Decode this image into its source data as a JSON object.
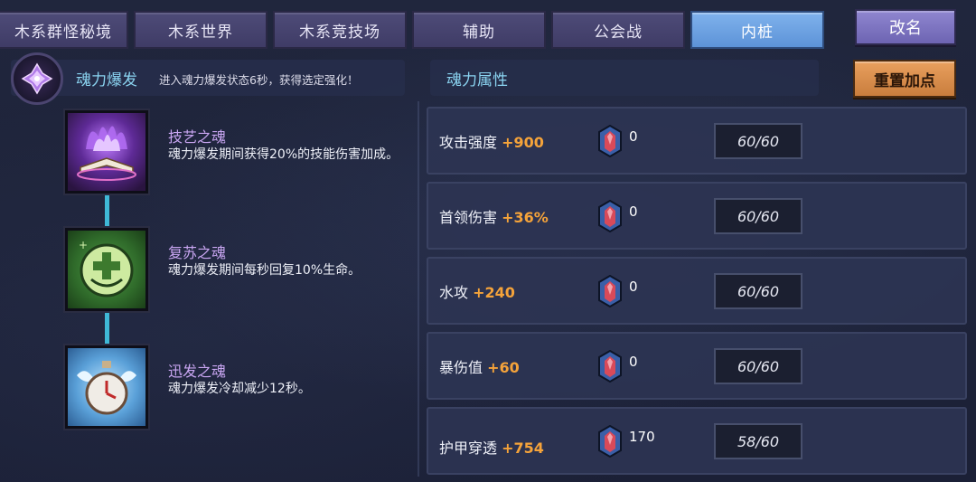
{
  "tabs": [
    "木系群怪秘境",
    "木系世界",
    "木系竞技场",
    "辅助",
    "公会战",
    "内桩"
  ],
  "rename_label": "改名",
  "burst": {
    "title": "魂力爆发",
    "desc": "进入魂力爆发状态6秒，获得选定强化！"
  },
  "souls": [
    {
      "name": "技艺之魂",
      "desc": "魂力爆发期间获得20%的技能伤害加成。",
      "icon": "purple-flame-book-icon"
    },
    {
      "name": "复苏之魂",
      "desc": "魂力爆发期间每秒回复10%生命。",
      "icon": "green-heal-cross-icon"
    },
    {
      "name": "迅发之魂",
      "desc": "魂力爆发冷却减少12秒。",
      "icon": "winged-clock-icon"
    }
  ],
  "attributes_panel": {
    "title": "魂力属性",
    "reset_label": "重置加点"
  },
  "attributes": [
    {
      "name": "攻击强度",
      "bonus": "+900",
      "gems": "0",
      "cap": "60/60"
    },
    {
      "name": "首领伤害",
      "bonus": "+36%",
      "gems": "0",
      "cap": "60/60"
    },
    {
      "name": "水攻",
      "bonus": "+240",
      "gems": "0",
      "cap": "60/60"
    },
    {
      "name": "暴伤值",
      "bonus": "+60",
      "gems": "0",
      "cap": "60/60"
    },
    {
      "name": "护甲穿透",
      "bonus": "+754",
      "gems": "170",
      "cap": "58/60"
    }
  ],
  "colors": {
    "active_tab": "#6fa3e4",
    "accent_cyan": "#8ad3f0",
    "soul_name": "#c9a6f2",
    "bonus_orange": "#f5a33a"
  }
}
